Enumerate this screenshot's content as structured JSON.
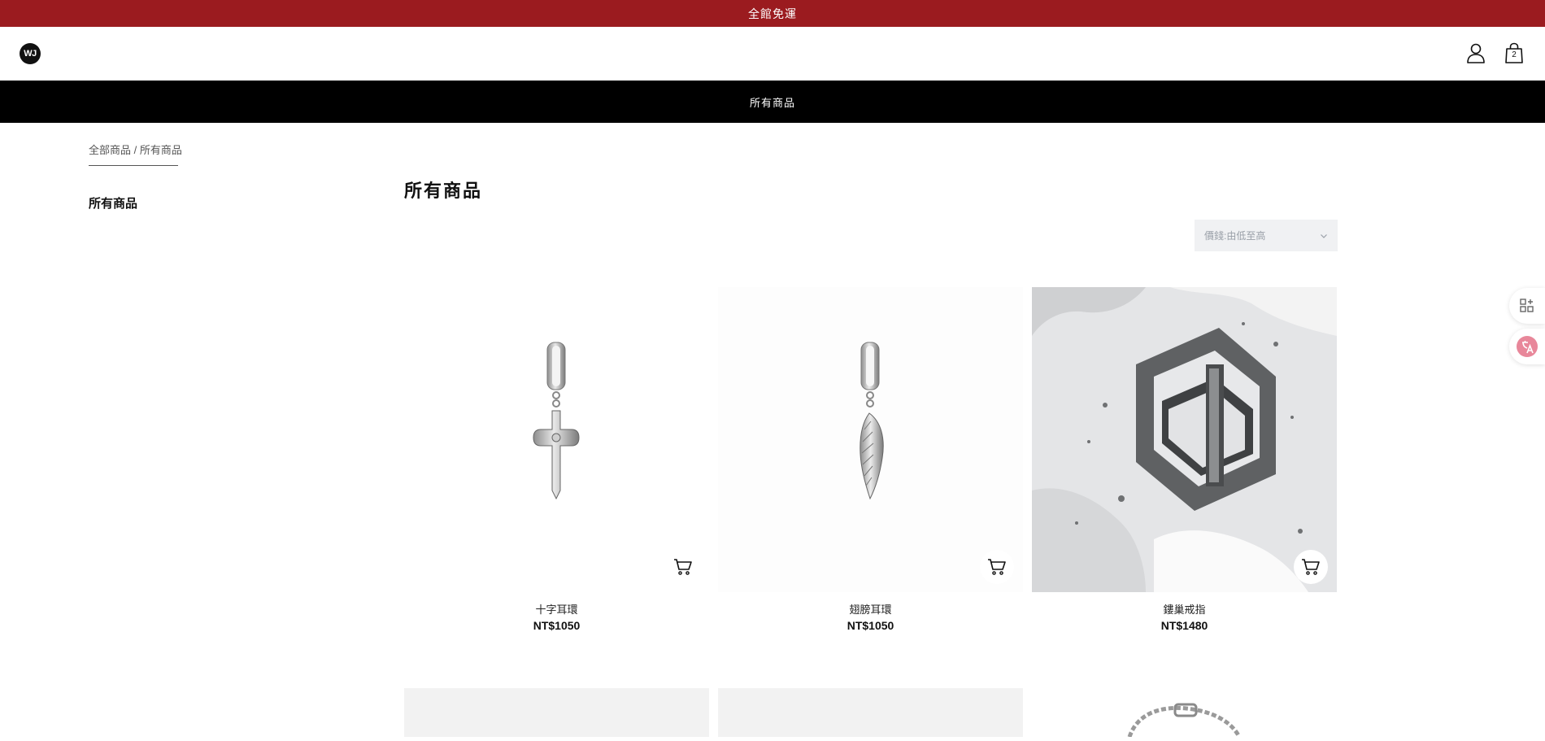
{
  "announcement": "全館免運",
  "header": {
    "logo_text": "WJ",
    "cart_count": "2"
  },
  "nav": {
    "items": [
      {
        "label": "所有商品"
      }
    ]
  },
  "breadcrumb": {
    "root": "全部商品",
    "separator": " / ",
    "current": "所有商品"
  },
  "sidebar": {
    "categories": [
      {
        "label": "所有商品"
      }
    ]
  },
  "main": {
    "title": "所有商品",
    "sort": {
      "selected": "價錢:由低至高"
    },
    "products": [
      {
        "name": "十字耳環",
        "price": "NT$1050"
      },
      {
        "name": "翅膀耳環",
        "price": "NT$1050"
      },
      {
        "name": "鏤巢戒指",
        "price": "NT$1480"
      }
    ]
  },
  "colors": {
    "announce_bg": "#9b1b1f",
    "nav_bg": "#000000",
    "translate_accent": "#e8879a"
  },
  "icons": [
    "user-icon",
    "shopping-bag-icon",
    "chevron-down-icon",
    "cart-icon",
    "apps-icon",
    "translate-icon"
  ]
}
